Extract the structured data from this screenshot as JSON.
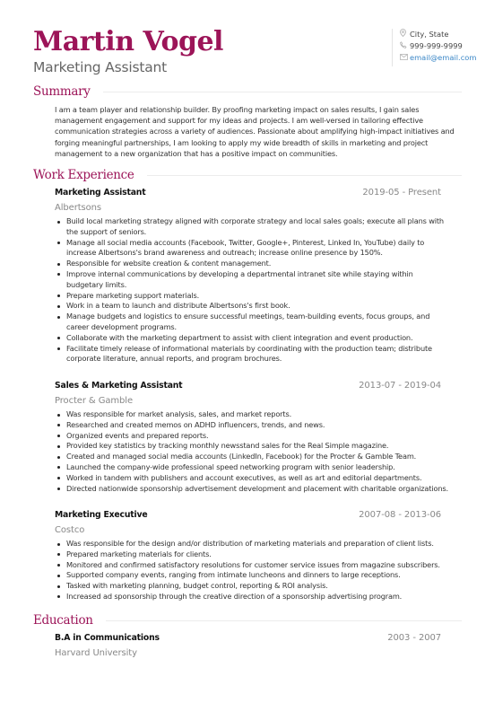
{
  "header": {
    "name": "Martin Vogel",
    "title": "Marketing Assistant"
  },
  "contact": {
    "location": {
      "icon": "location-pin-icon",
      "text": "City, State"
    },
    "phone": {
      "icon": "phone-icon",
      "text": "999-999-9999"
    },
    "email": {
      "icon": "envelope-icon",
      "text": "email@email.com"
    }
  },
  "colors": {
    "accent": "#9c1458",
    "link": "#3b87c7",
    "muted": "#888888"
  },
  "summary": {
    "heading": "Summary",
    "text": "I am a team player and relationship builder. By proofing marketing impact on sales results, I gain sales management engagement and support for my ideas and projects. I am well-versed in tailoring effective communication strategies across a variety of audiences. Passionate about amplifying high-impact initiatives and forging meaningful partnerships, I am looking to apply my wide breadth of skills in marketing and project management to a new organization that has a positive impact on communities."
  },
  "work": {
    "heading": "Work Experience",
    "jobs": [
      {
        "title": "Marketing Assistant",
        "dates": "2019-05 - Present",
        "company": "Albertsons",
        "bullets": [
          "Build local marketing strategy aligned with corporate strategy and local sales goals; execute all plans with the support of seniors.",
          "Manage all social media accounts (Facebook, Twitter, Google+, Pinterest, Linked In, YouTube) daily to increase Albertsons's brand awareness and outreach; increase online presence by 150%.",
          "Responsible for website creation & content management.",
          "Improve internal communications by developing a departmental intranet site while staying within budgetary limits.",
          "Prepare marketing support materials.",
          "Work in a team to launch and distribute Albertsons's first book.",
          "Manage budgets and logistics to ensure successful meetings, team-building events, focus groups, and career development programs.",
          "Collaborate with the marketing department to assist with client integration and event production.",
          "Facilitate timely release of informational materials by coordinating with the production team; distribute corporate literature, annual reports, and program brochures."
        ]
      },
      {
        "title": "Sales & Marketing Assistant",
        "dates": "2013-07 - 2019-04",
        "company": "Procter & Gamble",
        "bullets": [
          "Was responsible for market analysis, sales, and market reports.",
          "Researched and created memos on ADHD influencers, trends, and news.",
          "Organized events and prepared reports.",
          "Provided key statistics by tracking monthly newsstand sales for the Real Simple magazine.",
          "Created and managed social media accounts (LinkedIn, Facebook) for the Procter & Gamble Team.",
          "Launched the company-wide professional speed networking program with senior leadership.",
          "Worked in tandem with publishers and account executives, as well as art and editorial departments.",
          "Directed nationwide sponsorship advertisement development and placement with charitable organizations."
        ]
      },
      {
        "title": "Marketing Executive",
        "dates": "2007-08 - 2013-06",
        "company": "Costco",
        "bullets": [
          "Was responsible for the design and/or distribution of marketing materials and preparation of client lists.",
          "Prepared marketing materials for clients.",
          "Monitored and confirmed satisfactory resolutions for customer service issues from magazine subscribers.",
          "Supported company events, ranging from intimate luncheons and dinners to large receptions.",
          "Tasked with marketing planning, budget control, reporting & ROI analysis.",
          "Increased ad sponsorship through the creative direction of a sponsorship advertising program."
        ]
      }
    ]
  },
  "education": {
    "heading": "Education",
    "entries": [
      {
        "degree": "B.A in Communications",
        "dates": "2003 - 2007",
        "school": "Harvard University"
      }
    ]
  }
}
